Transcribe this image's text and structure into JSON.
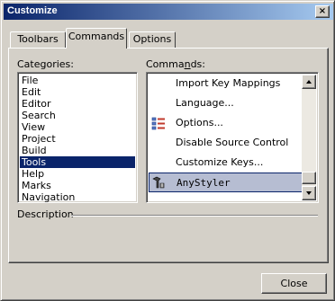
{
  "window": {
    "title": "Customize",
    "close_glyph": "×"
  },
  "tabs": [
    {
      "label": "Toolbars",
      "active": false
    },
    {
      "label": "Commands",
      "active": true
    },
    {
      "label": "Options",
      "active": false
    }
  ],
  "categories": {
    "label": "Categories:",
    "items": [
      "File",
      "Edit",
      "Editor",
      "Search",
      "View",
      "Project",
      "Build",
      "Tools",
      "Help",
      "Marks",
      "Navigation"
    ],
    "selected": "Tools"
  },
  "commands": {
    "label_pre": "Comma",
    "label_u": "n",
    "label_post": "ds:",
    "items": [
      {
        "label": "Import Key Mappings",
        "icon": "none"
      },
      {
        "label": "Language...",
        "icon": "none"
      },
      {
        "label": "Options...",
        "icon": "options-list-icon"
      },
      {
        "label": "Disable Source Control",
        "icon": "none"
      },
      {
        "label": "Customize Keys...",
        "icon": "none"
      },
      {
        "label": "AnyStyler",
        "icon": "anystyler-icon",
        "selected": true
      }
    ]
  },
  "description": {
    "label": "Description"
  },
  "close_button": {
    "label": "Close"
  },
  "colors": {
    "title_start": "#0a246a",
    "title_end": "#a6caf0",
    "selection": "#0a246a",
    "face": "#d4d0c8"
  }
}
